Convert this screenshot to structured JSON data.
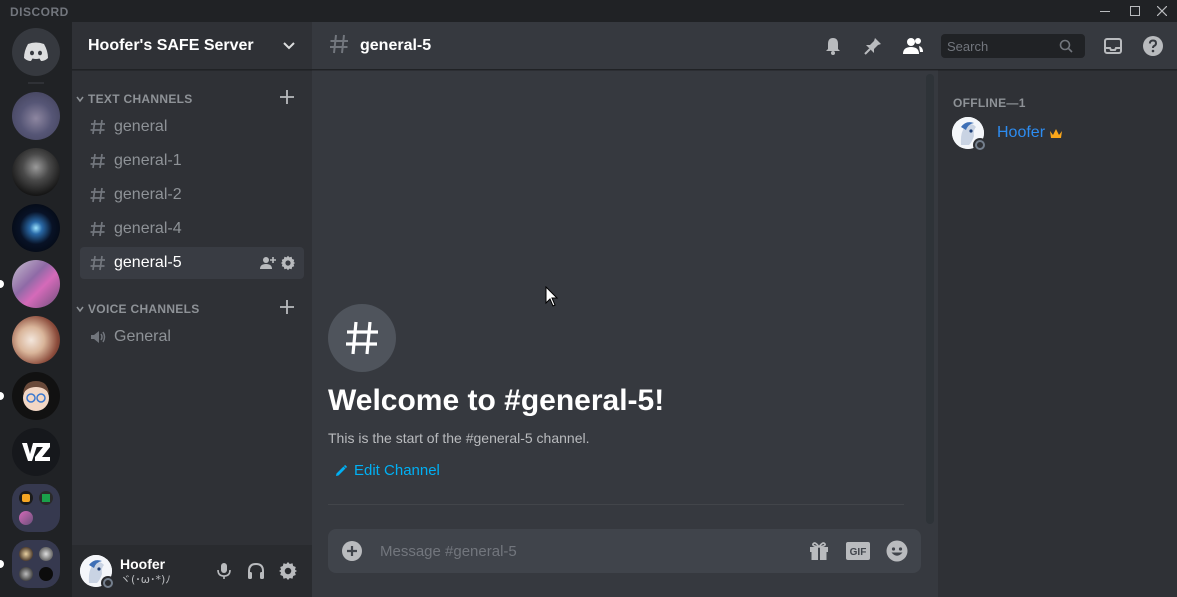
{
  "titlebar": {
    "brand": "DISCORD"
  },
  "server": {
    "name": "Hoofer's SAFE Server",
    "categories": [
      {
        "label": "TEXT CHANNELS",
        "channels": [
          {
            "name": "general",
            "type": "text"
          },
          {
            "name": "general-1",
            "type": "text"
          },
          {
            "name": "general-2",
            "type": "text"
          },
          {
            "name": "general-4",
            "type": "text"
          },
          {
            "name": "general-5",
            "type": "text",
            "active": true
          }
        ]
      },
      {
        "label": "VOICE CHANNELS",
        "channels": [
          {
            "name": "General",
            "type": "voice"
          }
        ]
      }
    ]
  },
  "user": {
    "name": "Hoofer",
    "status": "ヾ(･ω･*)ﾉ"
  },
  "chat": {
    "channel": "general-5",
    "search_placeholder": "Search",
    "welcome_title": "Welcome to #general-5!",
    "welcome_sub": "This is the start of the #general-5 channel.",
    "edit_label": "Edit Channel",
    "composer_placeholder": "Message #general-5",
    "gif_label": "GIF"
  },
  "members": {
    "category": "OFFLINE—1",
    "list": [
      {
        "name": "Hoofer",
        "role_color": "#2d8cf0",
        "owner": true
      }
    ]
  },
  "colors": {
    "accent": "#7289da",
    "link": "#00b0f4",
    "owner_crown": "#faa61a"
  }
}
